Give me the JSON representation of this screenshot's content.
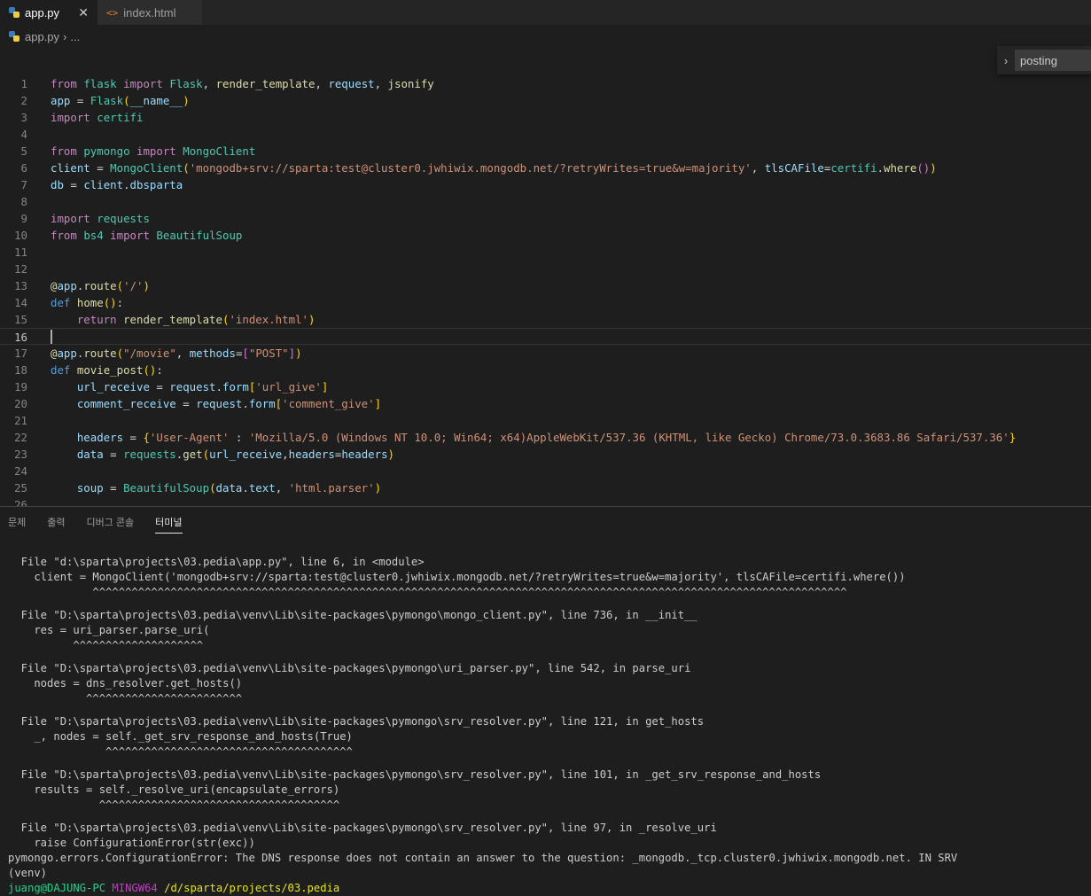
{
  "tabs": [
    {
      "label": "app.py",
      "active": true,
      "icon": "python-icon"
    },
    {
      "label": "index.html",
      "active": false,
      "icon": "html-icon"
    }
  ],
  "tab_close_symbol": "✕",
  "breadcrumb": {
    "file": "app.py",
    "rest": "..."
  },
  "find": {
    "value": "posting"
  },
  "editor": {
    "current_line": 16,
    "lines": [
      [
        [
          "kw",
          "from"
        ],
        [
          "pl",
          " "
        ],
        [
          "cls",
          "flask"
        ],
        [
          "pl",
          " "
        ],
        [
          "kw",
          "import"
        ],
        [
          "pl",
          " "
        ],
        [
          "cls",
          "Flask"
        ],
        [
          "pl",
          ", "
        ],
        [
          "fn",
          "render_template"
        ],
        [
          "pl",
          ", "
        ],
        [
          "var",
          "request"
        ],
        [
          "pl",
          ", "
        ],
        [
          "fn",
          "jsonify"
        ]
      ],
      [
        [
          "var",
          "app"
        ],
        [
          "pl",
          " = "
        ],
        [
          "cls",
          "Flask"
        ],
        [
          "br",
          "("
        ],
        [
          "var",
          "__name__"
        ],
        [
          "br",
          ")"
        ]
      ],
      [
        [
          "kw",
          "import"
        ],
        [
          "pl",
          " "
        ],
        [
          "cls",
          "certifi"
        ]
      ],
      [],
      [
        [
          "kw",
          "from"
        ],
        [
          "pl",
          " "
        ],
        [
          "cls",
          "pymongo"
        ],
        [
          "pl",
          " "
        ],
        [
          "kw",
          "import"
        ],
        [
          "pl",
          " "
        ],
        [
          "cls",
          "MongoClient"
        ]
      ],
      [
        [
          "var",
          "client"
        ],
        [
          "pl",
          " = "
        ],
        [
          "cls",
          "MongoClient"
        ],
        [
          "br",
          "("
        ],
        [
          "str",
          "'mongodb+srv://sparta:test@cluster0.jwhiwix.mongodb.net/?retryWrites=true&w=majority'"
        ],
        [
          "pl",
          ", "
        ],
        [
          "var",
          "tlsCAFile"
        ],
        [
          "pl",
          "="
        ],
        [
          "cls",
          "certifi"
        ],
        [
          "pl",
          "."
        ],
        [
          "fn",
          "where"
        ],
        [
          "br2",
          "()"
        ],
        [
          "br",
          ")"
        ]
      ],
      [
        [
          "var",
          "db"
        ],
        [
          "pl",
          " = "
        ],
        [
          "var",
          "client"
        ],
        [
          "pl",
          "."
        ],
        [
          "var",
          "dbsparta"
        ]
      ],
      [],
      [
        [
          "kw",
          "import"
        ],
        [
          "pl",
          " "
        ],
        [
          "cls",
          "requests"
        ]
      ],
      [
        [
          "kw",
          "from"
        ],
        [
          "pl",
          " "
        ],
        [
          "cls",
          "bs4"
        ],
        [
          "pl",
          " "
        ],
        [
          "kw",
          "import"
        ],
        [
          "pl",
          " "
        ],
        [
          "cls",
          "BeautifulSoup"
        ]
      ],
      [],
      [],
      [
        [
          "fn",
          "@"
        ],
        [
          "var",
          "app"
        ],
        [
          "pl",
          "."
        ],
        [
          "fn",
          "route"
        ],
        [
          "br",
          "("
        ],
        [
          "str",
          "'/'"
        ],
        [
          "br",
          ")"
        ]
      ],
      [
        [
          "kwd",
          "def"
        ],
        [
          "pl",
          " "
        ],
        [
          "fn",
          "home"
        ],
        [
          "br",
          "()"
        ],
        [
          "pl",
          ":"
        ]
      ],
      [
        [
          "pl",
          "    "
        ],
        [
          "kw",
          "return"
        ],
        [
          "pl",
          " "
        ],
        [
          "fn",
          "render_template"
        ],
        [
          "br",
          "("
        ],
        [
          "str",
          "'index.html'"
        ],
        [
          "br",
          ")"
        ]
      ],
      [],
      [
        [
          "fn",
          "@"
        ],
        [
          "var",
          "app"
        ],
        [
          "pl",
          "."
        ],
        [
          "fn",
          "route"
        ],
        [
          "br",
          "("
        ],
        [
          "str",
          "\"/movie\""
        ],
        [
          "pl",
          ", "
        ],
        [
          "var",
          "methods"
        ],
        [
          "pl",
          "="
        ],
        [
          "br2",
          "["
        ],
        [
          "str",
          "\"POST\""
        ],
        [
          "br2",
          "]"
        ],
        [
          "br",
          ")"
        ]
      ],
      [
        [
          "kwd",
          "def"
        ],
        [
          "pl",
          " "
        ],
        [
          "fn",
          "movie_post"
        ],
        [
          "br",
          "()"
        ],
        [
          "pl",
          ":"
        ]
      ],
      [
        [
          "pl",
          "    "
        ],
        [
          "var",
          "url_receive"
        ],
        [
          "pl",
          " = "
        ],
        [
          "var",
          "request"
        ],
        [
          "pl",
          "."
        ],
        [
          "var",
          "form"
        ],
        [
          "br",
          "["
        ],
        [
          "str",
          "'url_give'"
        ],
        [
          "br",
          "]"
        ]
      ],
      [
        [
          "pl",
          "    "
        ],
        [
          "var",
          "comment_receive"
        ],
        [
          "pl",
          " = "
        ],
        [
          "var",
          "request"
        ],
        [
          "pl",
          "."
        ],
        [
          "var",
          "form"
        ],
        [
          "br",
          "["
        ],
        [
          "str",
          "'comment_give'"
        ],
        [
          "br",
          "]"
        ]
      ],
      [],
      [
        [
          "pl",
          "    "
        ],
        [
          "var",
          "headers"
        ],
        [
          "pl",
          " = "
        ],
        [
          "br",
          "{"
        ],
        [
          "str",
          "'User-Agent'"
        ],
        [
          "pl",
          " : "
        ],
        [
          "str",
          "'Mozilla/5.0 (Windows NT 10.0; Win64; x64)AppleWebKit/537.36 (KHTML, like Gecko) Chrome/73.0.3683.86 Safari/537.36'"
        ],
        [
          "br",
          "}"
        ]
      ],
      [
        [
          "pl",
          "    "
        ],
        [
          "var",
          "data"
        ],
        [
          "pl",
          " = "
        ],
        [
          "cls",
          "requests"
        ],
        [
          "pl",
          "."
        ],
        [
          "fn",
          "get"
        ],
        [
          "br",
          "("
        ],
        [
          "var",
          "url_receive"
        ],
        [
          "pl",
          ","
        ],
        [
          "var",
          "headers"
        ],
        [
          "pl",
          "="
        ],
        [
          "var",
          "headers"
        ],
        [
          "br",
          ")"
        ]
      ],
      [],
      [
        [
          "pl",
          "    "
        ],
        [
          "var",
          "soup"
        ],
        [
          "pl",
          " = "
        ],
        [
          "cls",
          "BeautifulSoup"
        ],
        [
          "br",
          "("
        ],
        [
          "var",
          "data"
        ],
        [
          "pl",
          "."
        ],
        [
          "var",
          "text"
        ],
        [
          "pl",
          ", "
        ],
        [
          "str",
          "'html.parser'"
        ],
        [
          "br",
          ")"
        ]
      ],
      []
    ]
  },
  "panel": {
    "tabs": [
      {
        "label": "문제",
        "active": false
      },
      {
        "label": "출력",
        "active": false
      },
      {
        "label": "디버그 콘솔",
        "active": false
      },
      {
        "label": "터미널",
        "active": true
      }
    ],
    "terminal": [
      "  File \"d:\\sparta\\projects\\03.pedia\\app.py\", line 6, in <module>",
      "    client = MongoClient('mongodb+srv://sparta:test@cluster0.jwhiwix.mongodb.net/?retryWrites=true&w=majority', tlsCAFile=certifi.where())",
      "             ^^^^^^^^^^^^^^^^^^^^^^^^^^^^^^^^^^^^^^^^^^^^^^^^^^^^^^^^^^^^^^^^^^^^^^^^^^^^^^^^^^^^^^^^^^^^^^^^^^^^^^^^^^^^^^^^^^^^",
      "",
      "  File \"D:\\sparta\\projects\\03.pedia\\venv\\Lib\\site-packages\\pymongo\\mongo_client.py\", line 736, in __init__",
      "    res = uri_parser.parse_uri(",
      "          ^^^^^^^^^^^^^^^^^^^^",
      "",
      "  File \"D:\\sparta\\projects\\03.pedia\\venv\\Lib\\site-packages\\pymongo\\uri_parser.py\", line 542, in parse_uri",
      "    nodes = dns_resolver.get_hosts()",
      "            ^^^^^^^^^^^^^^^^^^^^^^^^",
      "",
      "  File \"D:\\sparta\\projects\\03.pedia\\venv\\Lib\\site-packages\\pymongo\\srv_resolver.py\", line 121, in get_hosts",
      "    _, nodes = self._get_srv_response_and_hosts(True)",
      "               ^^^^^^^^^^^^^^^^^^^^^^^^^^^^^^^^^^^^^^",
      "",
      "  File \"D:\\sparta\\projects\\03.pedia\\venv\\Lib\\site-packages\\pymongo\\srv_resolver.py\", line 101, in _get_srv_response_and_hosts",
      "    results = self._resolve_uri(encapsulate_errors)",
      "              ^^^^^^^^^^^^^^^^^^^^^^^^^^^^^^^^^^^^^",
      "",
      "  File \"D:\\sparta\\projects\\03.pedia\\venv\\Lib\\site-packages\\pymongo\\srv_resolver.py\", line 97, in _resolve_uri",
      "    raise ConfigurationError(str(exc))",
      "pymongo.errors.ConfigurationError: The DNS response does not contain an answer to the question: _mongodb._tcp.cluster0.jwhiwix.mongodb.net. IN SRV",
      "(venv)"
    ],
    "prompt": {
      "user": "juang@DAJUNG-PC",
      "host": "MINGW64",
      "path": "/d/sparta/projects/03.pedia"
    }
  },
  "colors": {
    "background": "#1e1e1e",
    "keyword": "#c586c0",
    "string": "#ce9178",
    "function": "#dcdcaa",
    "class": "#4ec9b0",
    "variable": "#9cdcfe"
  }
}
